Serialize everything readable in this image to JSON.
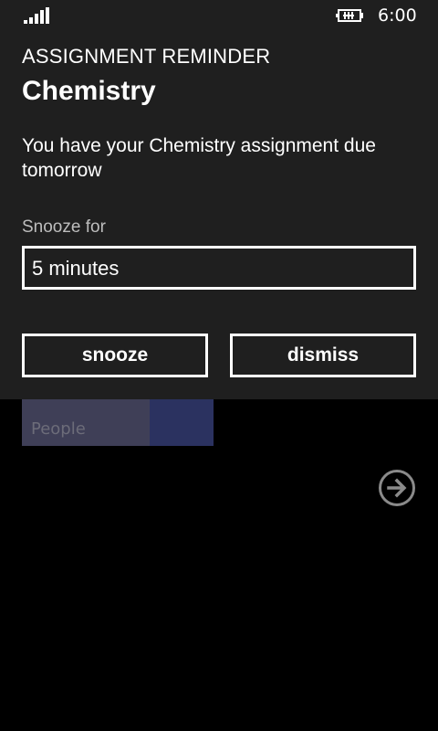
{
  "status_bar": {
    "time": "6:00",
    "signal_icon": "signal-strength-icon",
    "battery_icon": "battery-charging-icon"
  },
  "reminder": {
    "app_name": "ASSIGNMENT REMINDER",
    "title": "Chemistry",
    "message": "You have your Chemistry assignment due tomorrow",
    "snooze_label": "Snooze for",
    "snooze_value": "5 minutes",
    "snooze_button": "snooze",
    "dismiss_button": "dismiss",
    "background_color": "#1f1f1f"
  },
  "background": {
    "tile_label": "People",
    "tile_color": "#3f3f57",
    "arrow_icon": "arrow-right-circle-icon"
  }
}
